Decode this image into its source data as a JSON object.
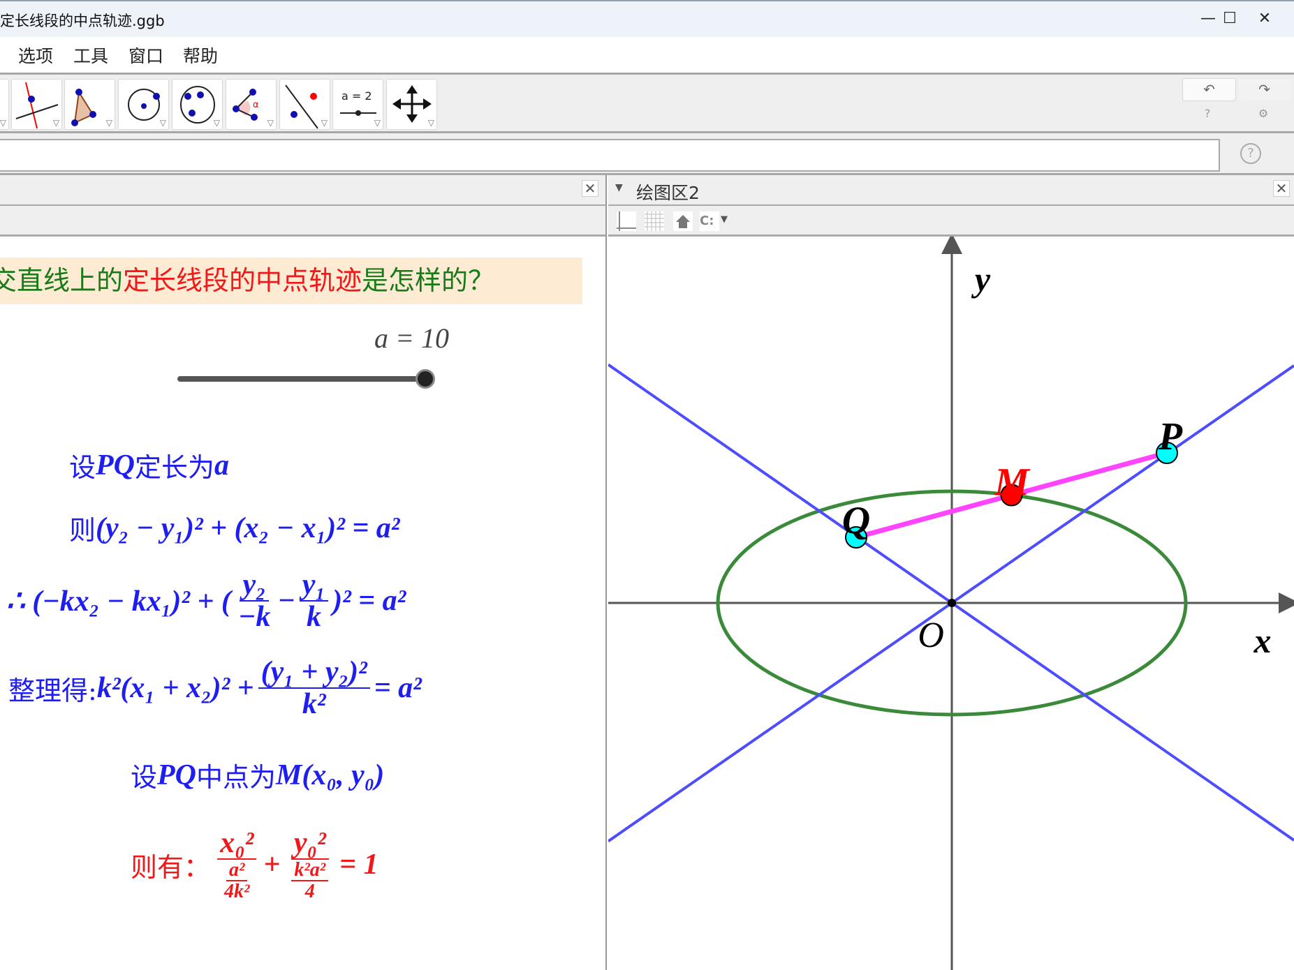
{
  "window": {
    "title": "定长线段的中点轨迹.ggb",
    "minimize": "—",
    "maximize": "☐",
    "close": "✕"
  },
  "menu": {
    "items": [
      "选项",
      "工具",
      "窗口",
      "帮助"
    ]
  },
  "toolbar": {
    "tools": [
      "perpendicular-line-tool",
      "polygon-tool",
      "circle-center-point-tool",
      "conic-five-points-tool",
      "angle-tool",
      "reflect-tool",
      "slider-tool",
      "move-graphics-view-tool"
    ],
    "slider_icon_label": "a = 2",
    "undo": "↶",
    "redo": "↷",
    "help": "?",
    "settings": "⚙"
  },
  "input_bar": {
    "value": "",
    "help": "?"
  },
  "algebra_panel": {
    "close": "✕",
    "banner": {
      "part1": "交直线上的",
      "part2": "定长线段的中点轨迹",
      "part3": "是怎样的？",
      "color_green": "#187a18",
      "color_red": "#f01818"
    },
    "slider": {
      "label": "a = 10",
      "value": 10,
      "fraction": 1.0
    },
    "math": {
      "line1_cn1": "设",
      "line1_m1": "PQ",
      "line1_cn2": "定长为",
      "line1_m2": "a",
      "line2_cn": "则",
      "line2_m": "(y₂ − y₁)² + (x₂ − x₁)² = a²",
      "line3_a": "∴ (−kx₂ − kx₁)² + (",
      "line3_f1n": "y₂",
      "line3_f1d": "−k",
      "line3_b": "−",
      "line3_f2n": "y₁",
      "line3_f2d": "k",
      "line3_c": ")² = a²",
      "line4_cn": "整理得:",
      "line4_a": "k²(x₁ + x₂)² +",
      "line4_fn": "(y₁ + y₂)²",
      "line4_fd": "k²",
      "line4_b": "= a²",
      "line5_cn1": "设",
      "line5_m1": "PQ",
      "line5_cn2": "中点为",
      "line5_m2": "M(x₀, y₀)",
      "line6_cn": "则有：",
      "line6_f1n": "x₀²",
      "line6_f1dn": "a²",
      "line6_f1dd": "4k²",
      "line6_plus": "+",
      "line6_f2n": "y₀²",
      "line6_f2dn": "k²a²",
      "line6_f2dd": "4",
      "line6_eq": "= 1",
      "color_blue": "#1e1ef0",
      "color_red": "#f01818"
    }
  },
  "graphics_panel": {
    "title": "绘图区2",
    "close": "✕",
    "toolbar": [
      "axes-toggle",
      "grid-toggle",
      "home-view",
      "point-capture-dropdown"
    ],
    "capture_label": "C:",
    "labels": {
      "P": "P",
      "Q": "Q",
      "M": "M",
      "O": "O",
      "x": "x",
      "y": "y"
    },
    "colors": {
      "lines": "#4d4dff",
      "ellipse": "#3a8a3a",
      "segment": "#ff44ff",
      "endpoints": "#00ffff",
      "midpoint": "#ff0000",
      "axes": "#555555"
    }
  }
}
